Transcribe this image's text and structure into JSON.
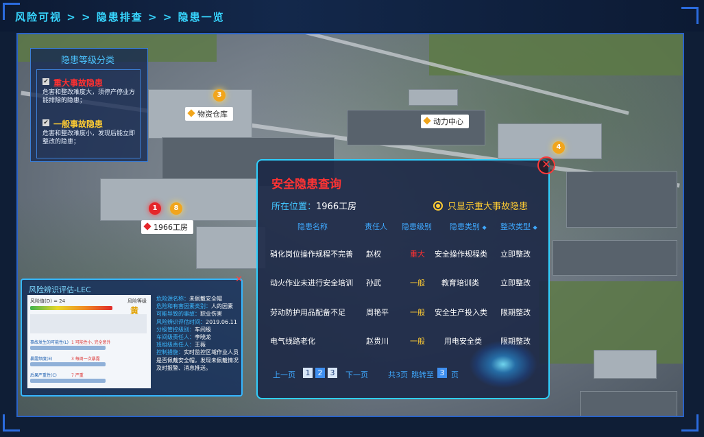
{
  "breadcrumb": "风险可视 > > 隐患排查 > > 隐患一览",
  "legend": {
    "title": "隐患等级分类",
    "items": [
      {
        "label": "重大事故隐患",
        "desc": "危害和整改难度大，须停产停业方能排除的隐患；",
        "color": "#ff3030"
      },
      {
        "label": "一般事故隐患",
        "desc": "危害和整改难度小，发现后能立即整改的隐患；",
        "color": "#ffcc33"
      }
    ]
  },
  "map": {
    "markers": [
      {
        "label": "物资仓库",
        "color": "#f1a51c"
      },
      {
        "label": "动力中心",
        "color": "#f1a51c"
      },
      {
        "label": "1966工房",
        "color": "#e5262a"
      }
    ],
    "pins": [
      "3",
      "4",
      "1",
      "8"
    ]
  },
  "lec": {
    "title": "风险辨识评估-LEC",
    "close": "✕",
    "image_texts": {
      "risk_value": "风险值(D) = 24",
      "level": "风险等级",
      "level_value": "黄",
      "row1": "事故发生的可能性(L)",
      "row1_value": "1 可能性小, 完全意外",
      "row2": "暴露频度(E)",
      "row2_value": "3 每周一次暴露",
      "row3": "后果严重性(C)",
      "row3_value": "7 严重"
    },
    "fields": [
      {
        "k": "危险源名称：",
        "v": "未佩戴安全帽"
      },
      {
        "k": "危险和有害因素类别：",
        "v": "人的因素"
      },
      {
        "k": "可能导致的事故：",
        "v": "职业伤害"
      },
      {
        "k": "风险辨识评估时间：",
        "v": "2019.06.11"
      },
      {
        "k": "分级管控级别：",
        "v": "车间级"
      },
      {
        "k": "车间级责任人：",
        "v": "李晓龙"
      },
      {
        "k": "班组级责任人：",
        "v": "王薇"
      },
      {
        "k": "控制措施：",
        "v": "实时监控区域作业人员"
      },
      {
        "k": "",
        "v": "是否佩戴安全帽，发现未佩戴情况"
      },
      {
        "k": "",
        "v": "及时报警、消息推送。"
      }
    ]
  },
  "query": {
    "title": "安全隐患查询",
    "location_label": "所在位置：",
    "location_value": "1966工房",
    "toggle_label": "只显示重大事故隐患",
    "close": "✕",
    "columns": [
      "隐患名称",
      "责任人",
      "隐患级别",
      "隐患类别",
      "整改类型"
    ],
    "rows": [
      {
        "name": "硝化岗位操作规程不完善",
        "owner": "赵权",
        "level": "重大",
        "category": "安全操作规程类",
        "rectify": "立即整改"
      },
      {
        "name": "动火作业未进行安全培训",
        "owner": "孙武",
        "level": "一般",
        "category": "教育培训类",
        "rectify": "立即整改"
      },
      {
        "name": "劳动防护用品配备不足",
        "owner": "周艳平",
        "level": "一般",
        "category": "安全生产投入类",
        "rectify": "限期整改"
      },
      {
        "name": "电气线路老化",
        "owner": "赵贵川",
        "level": "一般",
        "category": "用电安全类",
        "rectify": "限期整改"
      }
    ],
    "pager": {
      "prev": "上一页",
      "pages": [
        "1",
        "2",
        "3"
      ],
      "current": "2",
      "next": "下一页",
      "total": "共3页",
      "jump_label": "跳转至",
      "jump_value": "3",
      "page_unit": "页"
    }
  }
}
